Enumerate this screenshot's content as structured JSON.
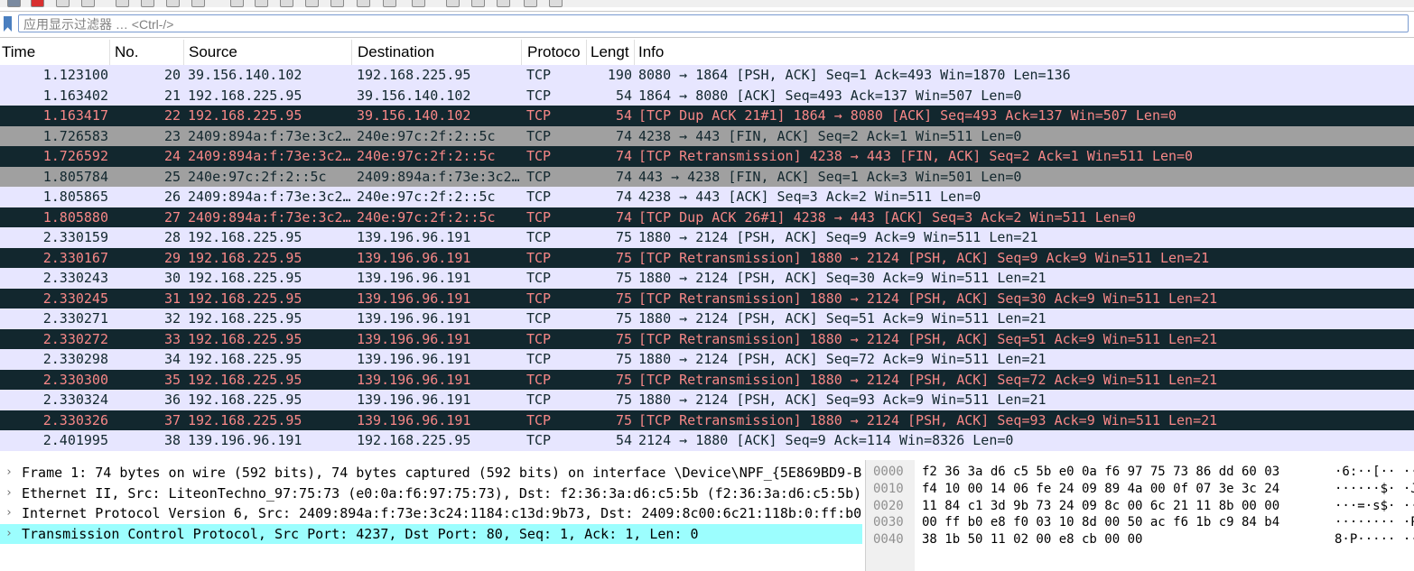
{
  "filter": {
    "placeholder": "应用显示过滤器 … <Ctrl-/>"
  },
  "colors": {
    "default_bg": "#e7e6ff",
    "default_fg": "#12272e",
    "bad_bg": "#12272e",
    "bad_fg": "#f78787",
    "fin_bg": "#a0a0a0",
    "fin_fg": "#12272e",
    "selected_detail_bg": "#9cfefe"
  },
  "columns": [
    "Time",
    "No.",
    "Source",
    "Destination",
    "Protoco",
    "Lengt",
    "Info"
  ],
  "packets": [
    {
      "time": "1.123100",
      "no": "20",
      "src": "39.156.140.102",
      "dst": "192.168.225.95",
      "proto": "TCP",
      "len": "190",
      "info": "8080 → 1864 [PSH, ACK] Seq=1 Ack=493 Win=1870 Len=136",
      "style": "default"
    },
    {
      "time": "1.163402",
      "no": "21",
      "src": "192.168.225.95",
      "dst": "39.156.140.102",
      "proto": "TCP",
      "len": "54",
      "info": "1864 → 8080 [ACK] Seq=493 Ack=137 Win=507 Len=0",
      "style": "default"
    },
    {
      "time": "1.163417",
      "no": "22",
      "src": "192.168.225.95",
      "dst": "39.156.140.102",
      "proto": "TCP",
      "len": "54",
      "info": "[TCP Dup ACK 21#1] 1864 → 8080 [ACK] Seq=493 Ack=137 Win=507 Len=0",
      "style": "bad"
    },
    {
      "time": "1.726583",
      "no": "23",
      "src": "2409:894a:f:73e:3c2…",
      "dst": "240e:97c:2f:2::5c",
      "proto": "TCP",
      "len": "74",
      "info": "4238 → 443 [FIN, ACK] Seq=2 Ack=1 Win=511 Len=0",
      "style": "fin"
    },
    {
      "time": "1.726592",
      "no": "24",
      "src": "2409:894a:f:73e:3c2…",
      "dst": "240e:97c:2f:2::5c",
      "proto": "TCP",
      "len": "74",
      "info": "[TCP Retransmission] 4238 → 443 [FIN, ACK] Seq=2 Ack=1 Win=511 Len=0",
      "style": "bad"
    },
    {
      "time": "1.805784",
      "no": "25",
      "src": "240e:97c:2f:2::5c",
      "dst": "2409:894a:f:73e:3c2…",
      "proto": "TCP",
      "len": "74",
      "info": "443 → 4238 [FIN, ACK] Seq=1 Ack=3 Win=501 Len=0",
      "style": "fin"
    },
    {
      "time": "1.805865",
      "no": "26",
      "src": "2409:894a:f:73e:3c2…",
      "dst": "240e:97c:2f:2::5c",
      "proto": "TCP",
      "len": "74",
      "info": "4238 → 443 [ACK] Seq=3 Ack=2 Win=511 Len=0",
      "style": "default"
    },
    {
      "time": "1.805880",
      "no": "27",
      "src": "2409:894a:f:73e:3c2…",
      "dst": "240e:97c:2f:2::5c",
      "proto": "TCP",
      "len": "74",
      "info": "[TCP Dup ACK 26#1] 4238 → 443 [ACK] Seq=3 Ack=2 Win=511 Len=0",
      "style": "bad"
    },
    {
      "time": "2.330159",
      "no": "28",
      "src": "192.168.225.95",
      "dst": "139.196.96.191",
      "proto": "TCP",
      "len": "75",
      "info": "1880 → 2124 [PSH, ACK] Seq=9 Ack=9 Win=511 Len=21",
      "style": "default"
    },
    {
      "time": "2.330167",
      "no": "29",
      "src": "192.168.225.95",
      "dst": "139.196.96.191",
      "proto": "TCP",
      "len": "75",
      "info": "[TCP Retransmission] 1880 → 2124 [PSH, ACK] Seq=9 Ack=9 Win=511 Len=21",
      "style": "bad"
    },
    {
      "time": "2.330243",
      "no": "30",
      "src": "192.168.225.95",
      "dst": "139.196.96.191",
      "proto": "TCP",
      "len": "75",
      "info": "1880 → 2124 [PSH, ACK] Seq=30 Ack=9 Win=511 Len=21",
      "style": "default"
    },
    {
      "time": "2.330245",
      "no": "31",
      "src": "192.168.225.95",
      "dst": "139.196.96.191",
      "proto": "TCP",
      "len": "75",
      "info": "[TCP Retransmission] 1880 → 2124 [PSH, ACK] Seq=30 Ack=9 Win=511 Len=21",
      "style": "bad"
    },
    {
      "time": "2.330271",
      "no": "32",
      "src": "192.168.225.95",
      "dst": "139.196.96.191",
      "proto": "TCP",
      "len": "75",
      "info": "1880 → 2124 [PSH, ACK] Seq=51 Ack=9 Win=511 Len=21",
      "style": "default"
    },
    {
      "time": "2.330272",
      "no": "33",
      "src": "192.168.225.95",
      "dst": "139.196.96.191",
      "proto": "TCP",
      "len": "75",
      "info": "[TCP Retransmission] 1880 → 2124 [PSH, ACK] Seq=51 Ack=9 Win=511 Len=21",
      "style": "bad"
    },
    {
      "time": "2.330298",
      "no": "34",
      "src": "192.168.225.95",
      "dst": "139.196.96.191",
      "proto": "TCP",
      "len": "75",
      "info": "1880 → 2124 [PSH, ACK] Seq=72 Ack=9 Win=511 Len=21",
      "style": "default"
    },
    {
      "time": "2.330300",
      "no": "35",
      "src": "192.168.225.95",
      "dst": "139.196.96.191",
      "proto": "TCP",
      "len": "75",
      "info": "[TCP Retransmission] 1880 → 2124 [PSH, ACK] Seq=72 Ack=9 Win=511 Len=21",
      "style": "bad"
    },
    {
      "time": "2.330324",
      "no": "36",
      "src": "192.168.225.95",
      "dst": "139.196.96.191",
      "proto": "TCP",
      "len": "75",
      "info": "1880 → 2124 [PSH, ACK] Seq=93 Ack=9 Win=511 Len=21",
      "style": "default"
    },
    {
      "time": "2.330326",
      "no": "37",
      "src": "192.168.225.95",
      "dst": "139.196.96.191",
      "proto": "TCP",
      "len": "75",
      "info": "[TCP Retransmission] 1880 → 2124 [PSH, ACK] Seq=93 Ack=9 Win=511 Len=21",
      "style": "bad"
    },
    {
      "time": "2.401995",
      "no": "38",
      "src": "139.196.96.191",
      "dst": "192.168.225.95",
      "proto": "TCP",
      "len": "54",
      "info": "2124 → 1880 [ACK] Seq=9 Ack=114 Win=8326 Len=0",
      "style": "default"
    }
  ],
  "details": [
    {
      "chevron": "›",
      "text": "Frame 1: 74 bytes on wire (592 bits), 74 bytes captured (592 bits) on interface \\Device\\NPF_{5E869BD9-B4",
      "selected": false
    },
    {
      "chevron": "›",
      "text": "Ethernet II, Src: LiteonTechno_97:75:73 (e0:0a:f6:97:75:73), Dst: f2:36:3a:d6:c5:5b (f2:36:3a:d6:c5:5b)",
      "selected": false
    },
    {
      "chevron": "›",
      "text": "Internet Protocol Version 6, Src: 2409:894a:f:73e:3c24:1184:c13d:9b73, Dst: 2409:8c00:6c21:118b:0:ff:b0e",
      "selected": false
    },
    {
      "chevron": "›",
      "text": "Transmission Control Protocol, Src Port: 4237, Dst Port: 80, Seq: 1, Ack: 1, Len: 0",
      "selected": true
    }
  ],
  "hex": [
    {
      "offset": "0000",
      "bytes": "f2 36 3a d6 c5 5b e0 0a  f6 97 75 73 86 dd 60 03",
      "ascii": "·6:··[··  ··us··`·"
    },
    {
      "offset": "0010",
      "bytes": "f4 10 00 14 06 fe 24 09  89 4a 00 0f 07 3e 3c 24",
      "ascii": "······$·  ·J···><$"
    },
    {
      "offset": "0020",
      "bytes": "11 84 c1 3d 9b 73 24 09  8c 00 6c 21 11 8b 00 00",
      "ascii": "···=·s$·  ··l!····"
    },
    {
      "offset": "0030",
      "bytes": "00 ff b0 e8 f0 03 10 8d  00 50 ac f6 1b c9 84 b4",
      "ascii": "········  ·P······"
    },
    {
      "offset": "0040",
      "bytes": "38 1b 50 11 02 00 e8 cb  00 00",
      "ascii": "8·P·····  ··"
    }
  ]
}
